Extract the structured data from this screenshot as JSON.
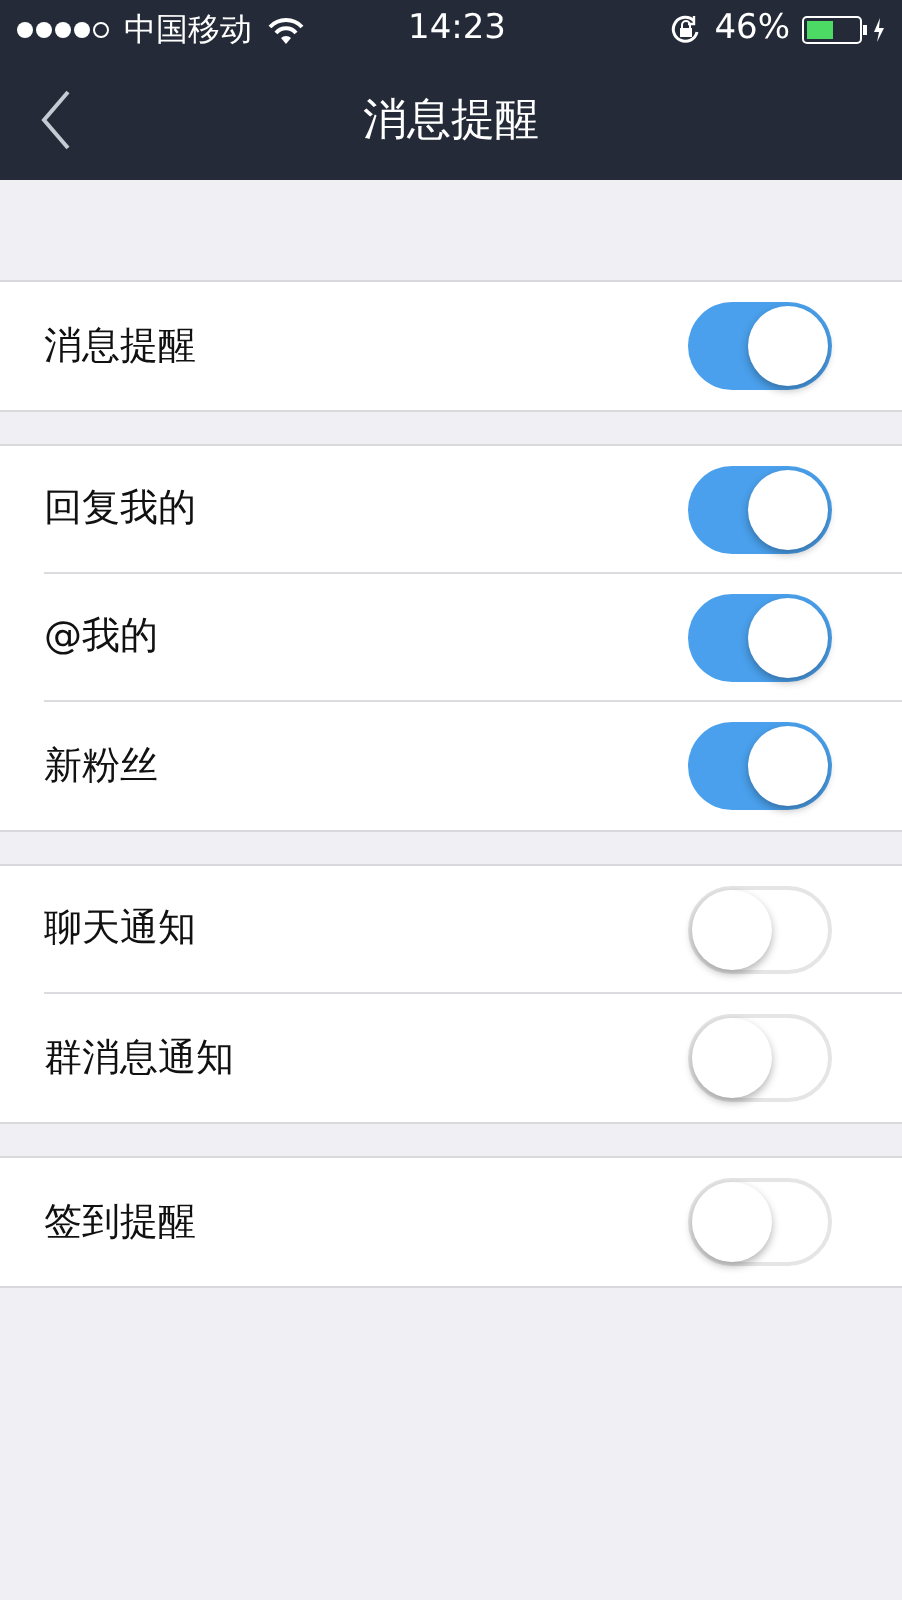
{
  "status_bar": {
    "carrier": "中国移动",
    "time": "14:23",
    "battery": "46%"
  },
  "nav": {
    "title": "消息提醒"
  },
  "groups": [
    {
      "rows": [
        {
          "label": "消息提醒",
          "on": true
        }
      ]
    },
    {
      "rows": [
        {
          "label": "回复我的",
          "on": true
        },
        {
          "label": "@我的",
          "on": true
        },
        {
          "label": "新粉丝",
          "on": true
        }
      ]
    },
    {
      "rows": [
        {
          "label": "聊天通知",
          "on": false
        },
        {
          "label": "群消息通知",
          "on": false
        }
      ]
    },
    {
      "rows": [
        {
          "label": "签到提醒",
          "on": false
        }
      ]
    }
  ]
}
